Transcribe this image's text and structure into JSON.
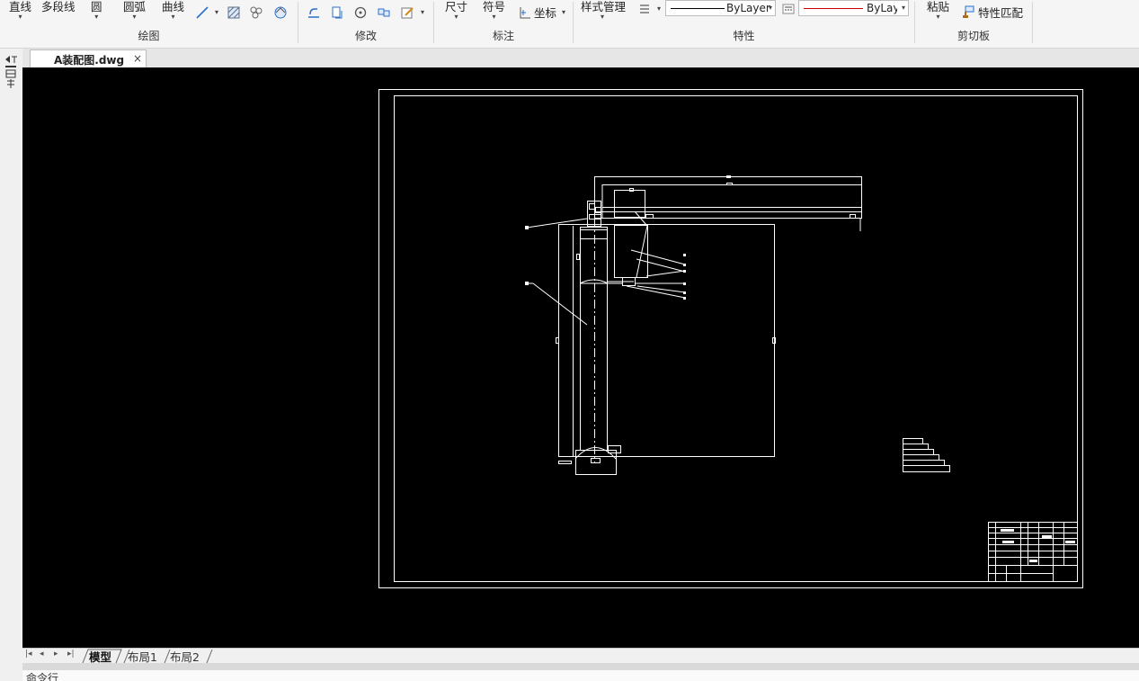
{
  "ribbon": {
    "draw": {
      "label": "绘图",
      "line": "直线",
      "polyline": "多段线",
      "circle": "圆",
      "arc": "圆弧",
      "curve": "曲线"
    },
    "modify": {
      "label": "修改"
    },
    "annotate": {
      "label": "标注",
      "dimension": "尺寸",
      "symbol": "符号",
      "coordinate": "坐标"
    },
    "properties": {
      "label": "特性",
      "style_manager": "样式管理",
      "linetype_value": "ByLayer",
      "color_value": "ByLayеr",
      "linetype_color": "#000000",
      "color_swatch": "#cc0000"
    },
    "clipboard": {
      "label": "剪切板",
      "paste": "粘贴",
      "match_properties": "特性匹配"
    }
  },
  "document": {
    "tab_name": "A装配图.dwg",
    "close_glyph": "×"
  },
  "canvas": {
    "background": "#000000",
    "drawing_color": "#ffffff"
  },
  "layout_tabs": [
    "模型",
    "布局1",
    "布局2"
  ],
  "active_layout": "模型",
  "command_line": {
    "label": "命令行"
  }
}
